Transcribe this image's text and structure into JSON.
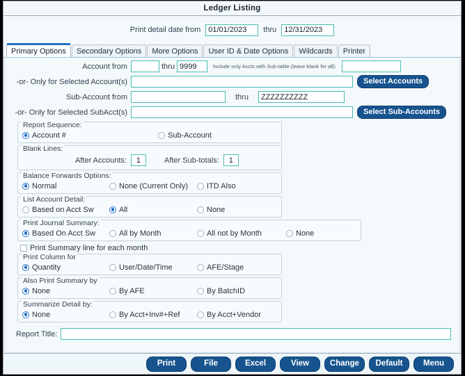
{
  "window": {
    "title": "Ledger Listing"
  },
  "date_filter": {
    "label_from": "Print detail date from",
    "from_value": "01/01/2023",
    "thru_label": "thru",
    "thru_value": "12/31/2023"
  },
  "tabs": [
    {
      "label": "Primary Options",
      "active": true
    },
    {
      "label": "Secondary Options",
      "active": false
    },
    {
      "label": "More Options",
      "active": false
    },
    {
      "label": "User ID & Date Options",
      "active": false
    },
    {
      "label": "Wildcards",
      "active": false
    },
    {
      "label": "Printer",
      "active": false
    }
  ],
  "account_row": {
    "label": "Account from",
    "from_value": "",
    "thru_label": "thru",
    "thru_value": "9999",
    "subtable_hint": "Include only Accts with Sub-table (leave blank for all):",
    "subtable_value": ""
  },
  "selected_accounts_row": {
    "label": "-or- Only for Selected Account(s)",
    "value": "",
    "button": "Select Accounts"
  },
  "subaccount_row": {
    "label": "Sub-Account from",
    "from_value": "",
    "thru_label": "thru",
    "thru_value": "ZZZZZZZZZZ"
  },
  "selected_subaccts_row": {
    "label": "-or- Only for Selected SubAcct(s)",
    "value": "",
    "button": "Select Sub-Accounts"
  },
  "report_sequence": {
    "caption": "Report Sequence:",
    "options": [
      {
        "label": "Account #",
        "selected": true
      },
      {
        "label": "Sub-Account",
        "selected": false
      }
    ]
  },
  "blank_lines": {
    "caption": "Blank Lines:",
    "after_accounts_label": "After Accounts:",
    "after_accounts_value": "1",
    "after_subtotals_label": "After Sub-totals:",
    "after_subtotals_value": "1"
  },
  "balance_forwards": {
    "caption": "Balance Forwards Options:",
    "options": [
      {
        "label": "Normal",
        "selected": true
      },
      {
        "label": "None (Current Only)",
        "selected": false
      },
      {
        "label": "ITD Also",
        "selected": false
      }
    ]
  },
  "list_account_detail": {
    "caption": "List Account Detail:",
    "options": [
      {
        "label": "Based on Acct Sw",
        "selected": false
      },
      {
        "label": "All",
        "selected": true
      },
      {
        "label": "None",
        "selected": false
      }
    ]
  },
  "print_journal_summary": {
    "caption": "Print Journal Summary:",
    "options": [
      {
        "label": "Based On Acct Sw",
        "selected": true
      },
      {
        "label": "All by Month",
        "selected": false
      },
      {
        "label": "All not by Month",
        "selected": false
      },
      {
        "label": "None",
        "selected": false
      }
    ]
  },
  "print_summary_line": {
    "label": "Print Summary line for each month",
    "checked": false
  },
  "print_column_for": {
    "caption": "Print Column for",
    "options": [
      {
        "label": "Quantity",
        "selected": true
      },
      {
        "label": "User/Date/Time",
        "selected": false
      },
      {
        "label": "AFE/Stage",
        "selected": false
      }
    ]
  },
  "also_print_summary_by": {
    "caption": "Also Print Summary by",
    "options": [
      {
        "label": "None",
        "selected": true
      },
      {
        "label": "By AFE",
        "selected": false
      },
      {
        "label": "By BatchID",
        "selected": false
      }
    ]
  },
  "summarize_detail_by": {
    "caption": "Summarize Detail by:",
    "options": [
      {
        "label": "None",
        "selected": true
      },
      {
        "label": "By Acct+Inv#+Ref",
        "selected": false
      },
      {
        "label": "By Acct+Vendor",
        "selected": false
      }
    ]
  },
  "report_title": {
    "label": "Report Title:",
    "value": ""
  },
  "footer_buttons": [
    {
      "label": "Print"
    },
    {
      "label": "File"
    },
    {
      "label": "Excel"
    },
    {
      "label": "View"
    },
    {
      "label": "Change"
    },
    {
      "label": "Default"
    },
    {
      "label": "Menu"
    }
  ],
  "colors": {
    "accent_button": "#17548f",
    "field_border": "#49bcb4",
    "radio_selected": "#2a72c8",
    "active_tab_bar": "#1f6fc4",
    "window_bg": "#f4f9fc"
  }
}
